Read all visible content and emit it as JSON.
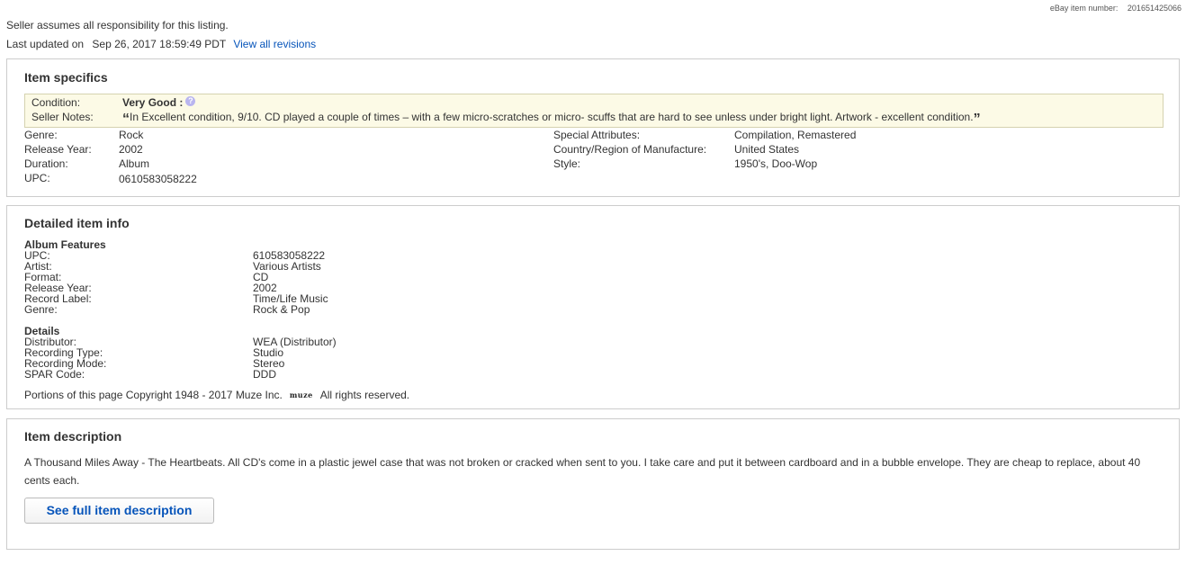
{
  "header": {
    "item_number_label": "eBay item number:",
    "item_number": "201651425066",
    "notice": "Seller assumes all responsibility for this listing.",
    "last_updated_label": "Last updated on",
    "last_updated": "Sep 26, 2017 18:59:49 PDT",
    "revisions_link": "View all revisions"
  },
  "item_specifics": {
    "title": "Item specifics",
    "condition_label": "Condition:",
    "condition_value": "Very Good :",
    "seller_notes_label": "Seller Notes:",
    "seller_notes": "In Excellent condition, 9/10. CD played a couple of times – with a few micro-scratches or micro- scuffs that are hard to see unless under bright light. Artwork - excellent condition.",
    "left": [
      {
        "label": "Genre:",
        "value": "Rock"
      },
      {
        "label": "Release Year:",
        "value": "2002"
      },
      {
        "label": "Duration:",
        "value": "Album"
      },
      {
        "label": "UPC:",
        "value": "0610583058222"
      }
    ],
    "right": [
      {
        "label": "Special Attributes:",
        "value": "Compilation, Remastered"
      },
      {
        "label": "Country/Region of Manufacture:",
        "value": "United States"
      },
      {
        "label": "Style:",
        "value": "1950's, Doo-Wop"
      }
    ]
  },
  "detailed_info": {
    "title": "Detailed item info",
    "album_features_heading": "Album Features",
    "album_features": [
      {
        "label": "UPC:",
        "value": "610583058222"
      },
      {
        "label": "Artist:",
        "value": "Various Artists"
      },
      {
        "label": "Format:",
        "value": "CD"
      },
      {
        "label": "Release Year:",
        "value": "2002"
      },
      {
        "label": "Record Label:",
        "value": "Time/Life Music"
      },
      {
        "label": "Genre:",
        "value": "Rock & Pop"
      }
    ],
    "details_heading": "Details",
    "details": [
      {
        "label": "Distributor:",
        "value": "WEA (Distributor)"
      },
      {
        "label": "Recording Type:",
        "value": "Studio"
      },
      {
        "label": "Recording Mode:",
        "value": "Stereo"
      },
      {
        "label": "SPAR Code:",
        "value": "DDD"
      }
    ],
    "copyright_prefix": "Portions of this page Copyright 1948 - 2017 Muze Inc.",
    "muze_logo_text": "muze",
    "copyright_suffix": "All rights reserved."
  },
  "item_description": {
    "title": "Item description",
    "text": "A Thousand Miles Away - The Heartbeats. All CD's come in a plastic jewel case that was not broken or cracked when sent to you. I take care and put it between cardboard and in a bubble envelope. They are cheap to replace, about 40 cents each.",
    "button_label": "See full item description"
  },
  "colors": {
    "link": "#0654ba",
    "condition_bg": "#fcfae6",
    "border": "#cccccc"
  }
}
